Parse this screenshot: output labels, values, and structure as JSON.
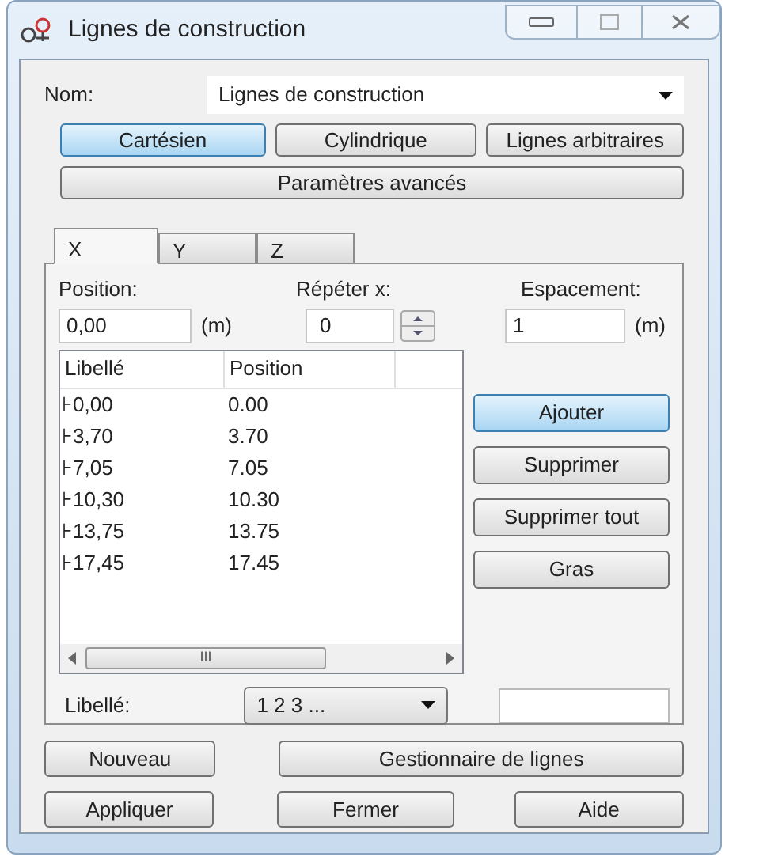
{
  "window": {
    "title": "Lignes de construction"
  },
  "name_field": {
    "label": "Nom:",
    "value": "Lignes de construction"
  },
  "coordinate_buttons": [
    {
      "label": "Cartésien",
      "selected": true
    },
    {
      "label": "Cylindrique",
      "selected": false
    },
    {
      "label": "Lignes arbitraires",
      "selected": false
    }
  ],
  "advanced_button": "Paramètres avancés",
  "tabs": [
    {
      "label": "X",
      "selected": true
    },
    {
      "label": "Y",
      "selected": false
    },
    {
      "label": "Z",
      "selected": false
    }
  ],
  "position": {
    "label": "Position:",
    "value": "0,00",
    "unit": "(m)"
  },
  "repeat": {
    "label": "Répéter x:",
    "value": "0"
  },
  "spacing": {
    "label": "Espacement:",
    "value": "1",
    "unit": "(m)"
  },
  "table": {
    "columns": [
      "Libellé",
      "Position"
    ],
    "rows": [
      [
        "⊦0,00",
        "0.00"
      ],
      [
        "⊦3,70",
        "3.70"
      ],
      [
        "⊦7,05",
        "7.05"
      ],
      [
        "⊦10,30",
        "10.30"
      ],
      [
        "⊦13,75",
        "13.75"
      ],
      [
        "⊦17,45",
        "17.45"
      ]
    ],
    "scrollbar_grip": "III"
  },
  "action_buttons": [
    {
      "label": "Ajouter",
      "focused": true
    },
    {
      "label": "Supprimer",
      "focused": false
    },
    {
      "label": "Supprimer tout",
      "focused": false
    },
    {
      "label": "Gras",
      "focused": false
    }
  ],
  "label_field": {
    "label": "Libellé:",
    "value": "1 2 3 ..."
  },
  "bottom_buttons": [
    [
      {
        "label": "Nouveau"
      },
      {
        "label": "Gestionnaire de lignes"
      }
    ],
    [
      {
        "label": "Appliquer"
      },
      {
        "label": "Fermer"
      },
      {
        "label": "Aide"
      }
    ]
  ]
}
